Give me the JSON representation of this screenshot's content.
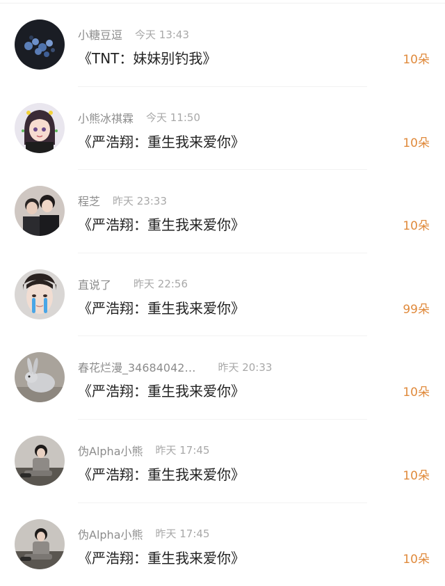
{
  "entries": [
    {
      "user": "小糖豆逗",
      "time": "今天 13:43",
      "title": "《TNT：妹妹别钓我》",
      "count": "10朵",
      "avatar": "blue-flowers-avatar"
    },
    {
      "user": "小熊冰祺霖",
      "time": "今天 11:50",
      "title": "《严浩翔：重生我来爱你》",
      "count": "10朵",
      "avatar": "cartoon-girl-avatar"
    },
    {
      "user": "程芝",
      "time": "昨天 23:33",
      "title": "《严浩翔：重生我来爱你》",
      "count": "10朵",
      "avatar": "two-boys-photo-avatar"
    },
    {
      "user": "直说了",
      "time": "昨天 22:56",
      "title": "《严浩翔：重生我来爱你》",
      "count": "99朵",
      "avatar": "crying-face-avatar"
    },
    {
      "user": "春花烂漫_34684042…",
      "time": "昨天 20:33",
      "title": "《严浩翔：重生我来爱你》",
      "count": "10朵",
      "avatar": "rabbit-avatar"
    },
    {
      "user": "伪Alpha小熊",
      "time": "昨天 17:45",
      "title": "《严浩翔：重生我来爱你》",
      "count": "10朵",
      "avatar": "sitting-boy-avatar"
    },
    {
      "user": "伪Alpha小熊",
      "time": "昨天 17:45",
      "title": "《严浩翔：重生我来爱你》",
      "count": "10朵",
      "avatar": "sitting-boy-avatar"
    }
  ],
  "colors": {
    "count": "#e08a3c",
    "username": "#8c8c8c",
    "time": "#a8a8a8",
    "title": "#222222"
  }
}
